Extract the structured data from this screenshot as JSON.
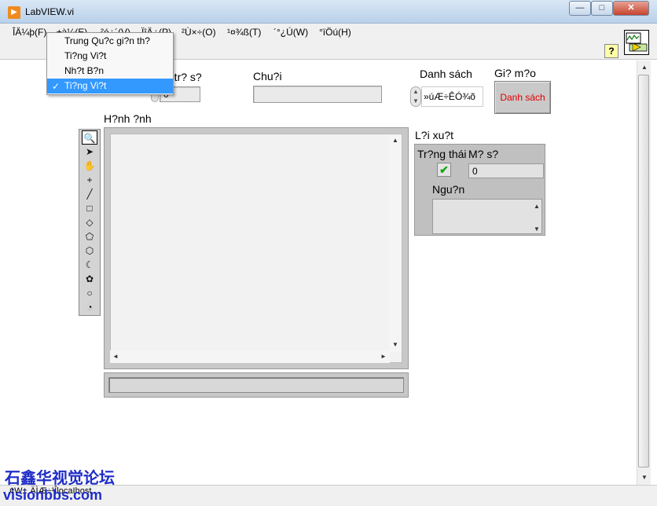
{
  "window": {
    "title": "LabVIEW.vi",
    "minimize": "—",
    "maximize": "□",
    "close": "✕"
  },
  "menu": [
    {
      "label": "ÎÄ¼þ(F)"
    },
    {
      "label": "±à¼­(E)"
    },
    {
      "label": "²é¿´(V)"
    },
    {
      "label": "ÏîÄ¿(P)"
    },
    {
      "label": "²Ù×÷(O)"
    },
    {
      "label": "¹¤¾ß(T)"
    },
    {
      "label": "´°¿Ú(W)"
    },
    {
      "label": "°ïÖú(H)"
    }
  ],
  "dropdown": {
    "items": [
      "Trung Qu?c gi?n th?",
      "Ti?ng Vi?t",
      "Nh?t B?n",
      "Ti?ng Vi?t"
    ],
    "selected_index": 3,
    "check": "✓"
  },
  "toolbar": {
    "help": "?"
  },
  "controls": {
    "numeric_label": "Giá tr? s?",
    "numeric_value": "0",
    "string_label": "Chu?i",
    "string_value": "",
    "ring_label": "Danh sách",
    "ring_value": "»úÆ÷ÊÓ¾õ",
    "ring_up": "▲",
    "ring_down": "▼",
    "button_label": "Gi? m?o",
    "button_text": "Danh sách",
    "picture_label": "H?nh ?nh"
  },
  "error": {
    "label": "L?i xu?t",
    "status_label": "Tr?ng thái",
    "status_check": "✔",
    "code_label": "M? s?",
    "code_value": "0",
    "source_label": "Ngu?n"
  },
  "scroll": {
    "up": "▲",
    "down": "▼",
    "left": "◄",
    "right": "►"
  },
  "tools": [
    "🔍",
    "➤",
    "✋",
    "+",
    "╱",
    "□",
    "◇",
    "⬠",
    "⬡",
    "☾",
    "✿",
    "○",
    "◔"
  ],
  "bottom": {
    "context": "¢W±¸ÄÌÆ÷¹ÎlocaIhost",
    "watermark_cn": "石鑫华视觉论坛",
    "watermark_url": "visionbbs.com"
  },
  "colors": {
    "button_text": "#e00000",
    "selection": "#3399ff",
    "check": "#14a514",
    "watermark": "#1f2cc8"
  }
}
